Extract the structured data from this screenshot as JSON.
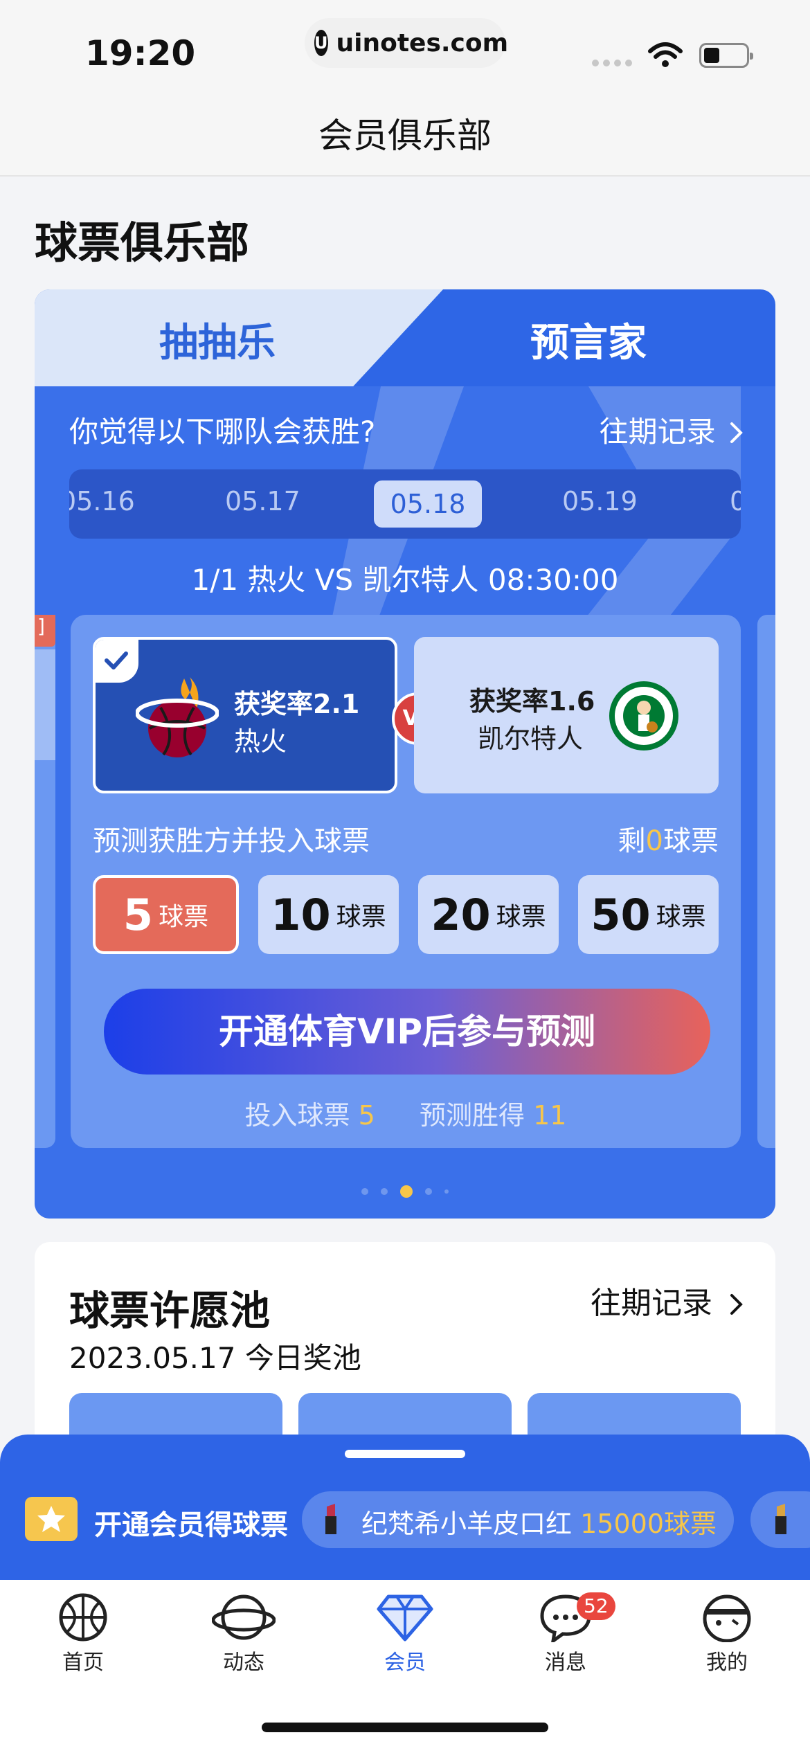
{
  "status_bar": {
    "time": "19:20",
    "url": "uinotes.com",
    "url_logo": "U"
  },
  "nav": {
    "title": "会员俱乐部"
  },
  "page": {
    "heading": "球票俱乐部"
  },
  "predictor": {
    "tabs": [
      {
        "label": "抽抽乐"
      },
      {
        "label": "预言家"
      }
    ],
    "question": "你觉得以下哪队会获胜?",
    "history_link": "往期记录",
    "dates": [
      {
        "label": "05.16",
        "selected": false
      },
      {
        "label": "05.17",
        "selected": false
      },
      {
        "label": "05.18",
        "selected": true
      },
      {
        "label": "05.19",
        "selected": false
      },
      {
        "label": "0",
        "selected": false
      }
    ],
    "match": "1/1 热火 VS 凯尔特人 08:30:00",
    "peek_tag": "]",
    "teams": [
      {
        "rate": "获奖率2.1",
        "name": "热火",
        "logo": "heat-logo",
        "selected": true
      },
      {
        "rate": "获奖率1.6",
        "name": "凯尔特人",
        "logo": "celtics-logo",
        "selected": false
      }
    ],
    "vs": "VS",
    "hint": "预测获胜方并投入球票",
    "remain": {
      "prefix": "剩",
      "count": "0",
      "suffix": "球票"
    },
    "chips": [
      {
        "num": "5",
        "unit": "球票",
        "selected": true
      },
      {
        "num": "10",
        "unit": "球票",
        "selected": false
      },
      {
        "num": "20",
        "unit": "球票",
        "selected": false
      },
      {
        "num": "50",
        "unit": "球票",
        "selected": false
      }
    ],
    "cta": "开通体育VIP后参与预测",
    "summary": {
      "bet_label": "投入球票",
      "bet_value": "5",
      "win_label": "预测胜得",
      "win_value": "11"
    },
    "pager": {
      "count": 5,
      "active": 2
    }
  },
  "wish_pool": {
    "title": "球票许愿池",
    "history_link": "往期记录",
    "date": "2023.05.17 今日奖池"
  },
  "promo": {
    "vip_text": "开通会员得球票",
    "prize_name": "纪梵希小羊皮口红",
    "prize_points": "15000球票"
  },
  "tabbar": {
    "items": [
      {
        "label": "首页",
        "icon": "basketball-icon"
      },
      {
        "label": "动态",
        "icon": "planet-icon"
      },
      {
        "label": "会员",
        "icon": "diamond-icon",
        "active": true
      },
      {
        "label": "消息",
        "icon": "chat-bubble-icon",
        "badge": "52"
      },
      {
        "label": "我的",
        "icon": "avatar-icon"
      }
    ]
  },
  "colors": {
    "primary": "#2e66e6",
    "accent_red": "#e46a5a",
    "gold": "#f7c64a"
  }
}
